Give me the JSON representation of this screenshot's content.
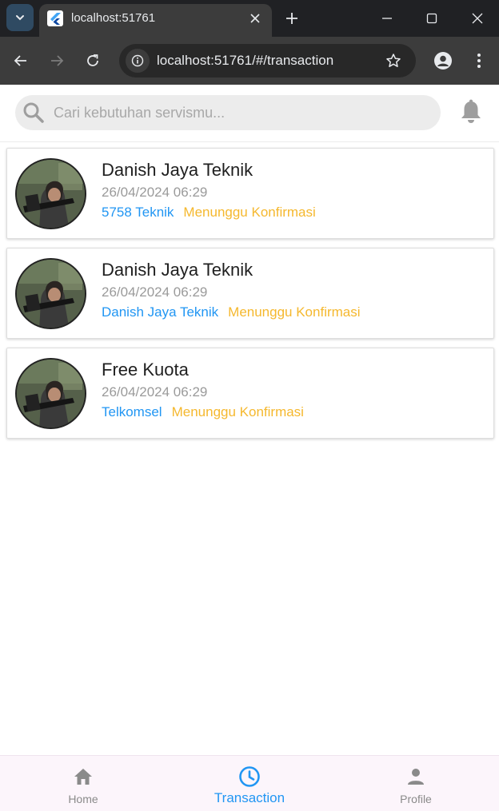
{
  "browser": {
    "tab_title": "localhost:51761",
    "url": "localhost:51761/#/transaction"
  },
  "search": {
    "placeholder": "Cari kebutuhan servismu..."
  },
  "transactions": [
    {
      "title": "Danish Jaya Teknik",
      "date": "26/04/2024 06:29",
      "vendor": "5758 Teknik",
      "status": "Menunggu Konfirmasi"
    },
    {
      "title": "Danish Jaya Teknik",
      "date": "26/04/2024 06:29",
      "vendor": "Danish Jaya Teknik",
      "status": "Menunggu Konfirmasi"
    },
    {
      "title": "Free Kuota",
      "date": "26/04/2024 06:29",
      "vendor": "Telkomsel",
      "status": "Menunggu Konfirmasi"
    }
  ],
  "bottom_nav": {
    "items": [
      {
        "label": "Home",
        "icon": "home-icon",
        "active": false
      },
      {
        "label": "Transaction",
        "icon": "clock-icon",
        "active": true
      },
      {
        "label": "Profile",
        "icon": "person-icon",
        "active": false
      }
    ]
  },
  "colors": {
    "accent": "#2196f3",
    "status_pending": "#f5b82e",
    "muted": "#9a9a9a"
  }
}
